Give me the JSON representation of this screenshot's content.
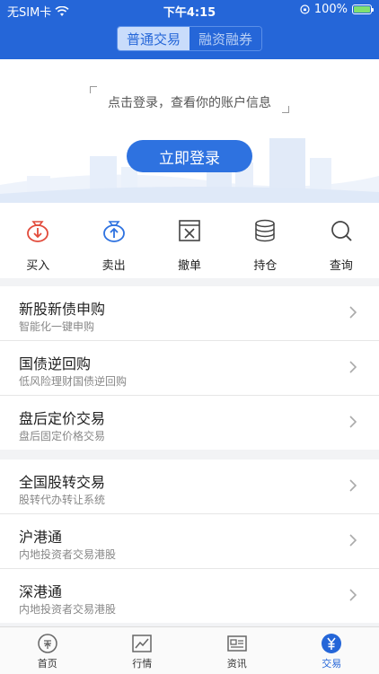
{
  "status_bar": {
    "carrier": "无SIM卡",
    "time": "下午4:15",
    "battery": "100%"
  },
  "header": {
    "tabs": [
      {
        "label": "普通交易",
        "active": true
      },
      {
        "label": "融资融券",
        "active": false
      }
    ]
  },
  "login": {
    "hint": "点击登录，查看你的账户信息",
    "button_label": "立即登录"
  },
  "quick_actions": [
    {
      "label": "买入",
      "icon": "buy-bag-icon"
    },
    {
      "label": "卖出",
      "icon": "sell-bag-icon"
    },
    {
      "label": "撤单",
      "icon": "cancel-order-icon"
    },
    {
      "label": "持仓",
      "icon": "coin-stack-icon"
    },
    {
      "label": "查询",
      "icon": "search-icon"
    }
  ],
  "menu_group_1": [
    {
      "title": "新股新债申购",
      "subtitle": "智能化一键申购"
    },
    {
      "title": "国债逆回购",
      "subtitle": "低风险理财国债逆回购"
    },
    {
      "title": "盘后定价交易",
      "subtitle": "盘后固定价格交易"
    }
  ],
  "menu_group_2": [
    {
      "title": "全国股转交易",
      "subtitle": "股转代办转让系统"
    },
    {
      "title": "沪港通",
      "subtitle": "内地投资者交易港股"
    },
    {
      "title": "深港通",
      "subtitle": "内地投资者交易港股"
    }
  ],
  "tab_bar": [
    {
      "label": "首页",
      "icon": "home-coupon-icon",
      "active": false
    },
    {
      "label": "行情",
      "icon": "market-chart-icon",
      "active": false
    },
    {
      "label": "资讯",
      "icon": "news-icon",
      "active": false
    },
    {
      "label": "交易",
      "icon": "yuan-icon",
      "active": true
    }
  ],
  "colors": {
    "brand": "#2566d8",
    "buy": "#e24b3b",
    "sell": "#2e72e0"
  }
}
